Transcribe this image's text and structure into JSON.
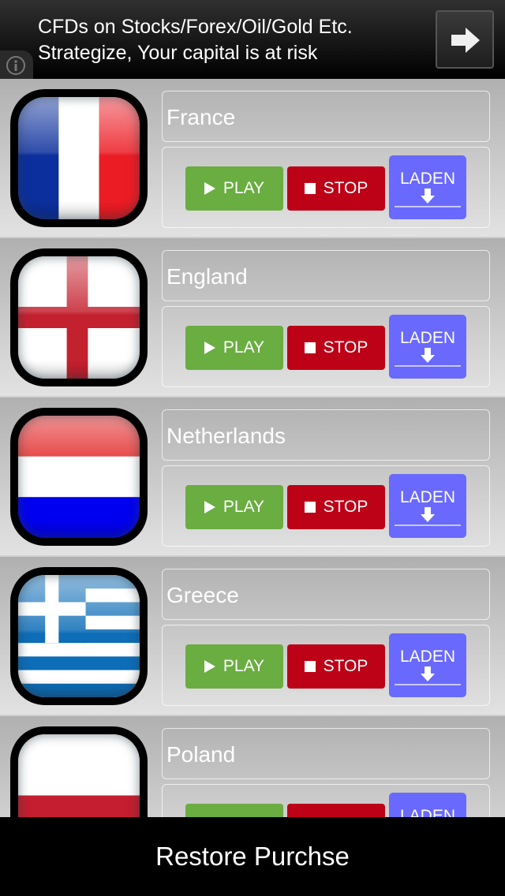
{
  "ad": {
    "line1": "CFDs on Stocks/Forex/Oil/Gold Etc.",
    "line2": "Strategize, Your capital is at risk",
    "info_icon": "info-icon",
    "arrow_icon": "arrow-right-icon"
  },
  "buttons": {
    "play": "PLAY",
    "stop": "STOP",
    "laden": "LADEN"
  },
  "countries": [
    {
      "name": "France",
      "flag": "france"
    },
    {
      "name": "England",
      "flag": "england"
    },
    {
      "name": "Netherlands",
      "flag": "netherlands"
    },
    {
      "name": "Greece",
      "flag": "greece"
    },
    {
      "name": "Poland",
      "flag": "poland"
    }
  ],
  "colors": {
    "play": "#6aad41",
    "stop": "#bd0218",
    "laden": "#6969fe"
  },
  "footer": {
    "restore_label": "Restore Purchse"
  }
}
